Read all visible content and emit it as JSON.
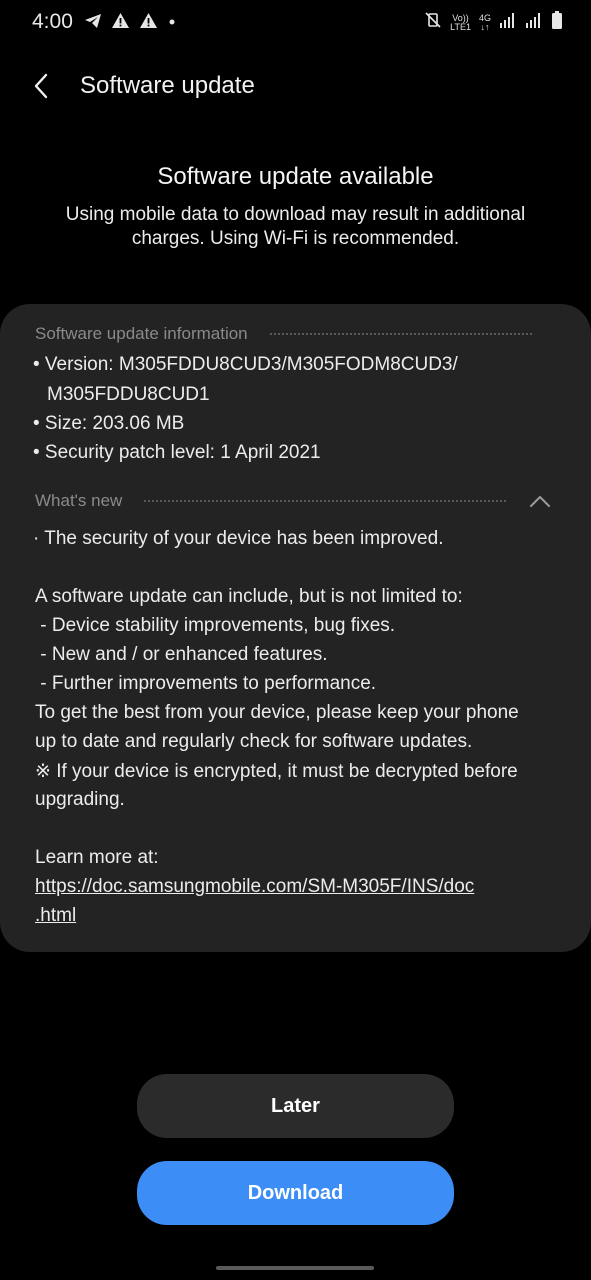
{
  "status_bar": {
    "time": "4:00",
    "left_icons": [
      "telegram-icon",
      "warning-icon",
      "warning-icon",
      "dot-icon"
    ],
    "network_top": "Vo))",
    "network_bottom": "LTE1",
    "network_type": "4G",
    "right_icons": [
      "mute-vibrate-icon",
      "signal-icon",
      "signal-icon",
      "battery-icon"
    ]
  },
  "header": {
    "title": "Software update",
    "back_icon": "chevron-left-icon"
  },
  "intro": {
    "title": "Software update available",
    "text_line1": "Using mobile data to download may result in additional",
    "text_line2": "charges. Using Wi-Fi is recommended."
  },
  "info_section": {
    "header": "Software update information",
    "version_line1": "• Version: M305FDDU8CUD3/M305FODM8CUD3/",
    "version_line2": "M305FDDU8CUD1",
    "size": "• Size: 203.06 MB",
    "security_patch": "• Security patch level: 1 April 2021"
  },
  "whats_new": {
    "header": "What's new",
    "collapse_icon": "chevron-up-icon",
    "lines": [
      "· The security of your device has been improved.",
      "A software update can include, but is not limited to:",
      " - Device stability improvements, bug fixes.",
      " - New and / or enhanced features.",
      " - Further improvements to performance.",
      "To get the best from your device, please keep your phone",
      "up to date and regularly check for software updates.",
      "※ If your device is encrypted, it must be decrypted before",
      "upgrading."
    ],
    "learn_more": "Learn more at:",
    "link_line1": "https://doc.samsungmobile.com/SM-M305F/INS/doc",
    "link_line2": ".html"
  },
  "buttons": {
    "later": "Later",
    "download": "Download"
  },
  "colors": {
    "background": "#000000",
    "card": "#232323",
    "primary_button": "#3c8df5",
    "secondary_button": "#2b2b2b"
  }
}
